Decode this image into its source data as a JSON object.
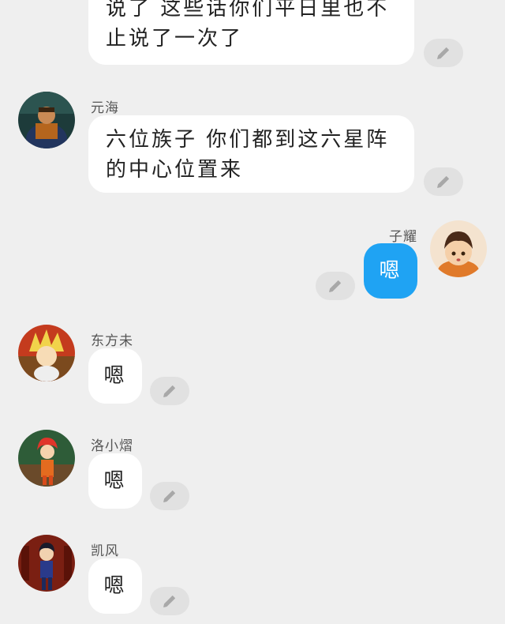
{
  "messages": [
    {
      "sender": "",
      "text": "说了 这些话你们平日里也不止说了一次了"
    },
    {
      "sender": "元海",
      "text": "六位族子 你们都到这六星阵的中心位置来"
    },
    {
      "sender": "子耀",
      "text": "嗯"
    },
    {
      "sender": "东方未",
      "text": "嗯"
    },
    {
      "sender": "洛小熠",
      "text": "嗯"
    },
    {
      "sender": "凯风",
      "text": "嗯"
    }
  ],
  "icons": {
    "edit": "pencil-icon"
  },
  "colors": {
    "background": "#efefef",
    "bubble_other": "#ffffff",
    "bubble_self": "#1fa3f3",
    "edit_button": "#e1e1e1"
  }
}
